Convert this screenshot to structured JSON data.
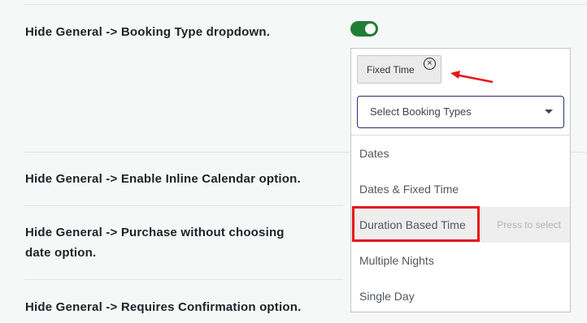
{
  "settings": {
    "booking_type": {
      "label": "Hide General -> Booking Type dropdown.",
      "toggle_on": true
    },
    "inline_calendar": {
      "label": "Hide General -> Enable Inline Calendar option."
    },
    "purchase_without_date": {
      "label_line1": "Hide General -> Purchase without choosing",
      "label_line2": "date option."
    },
    "requires_confirmation": {
      "label": "Hide General -> Requires Confirmation option."
    }
  },
  "multiselect": {
    "selected_chip": "Fixed Time",
    "remove_symbol": "×",
    "placeholder": "Select Booking Types",
    "options": [
      "Dates",
      "Dates & Fixed Time",
      "Duration Based Time",
      "Multiple Nights",
      "Single Day"
    ],
    "highlighted_hint": "Press to select"
  },
  "colors": {
    "toggle_on": "#1e7e34",
    "annotation_red": "#e8141a",
    "search_border": "#2a2f75"
  }
}
